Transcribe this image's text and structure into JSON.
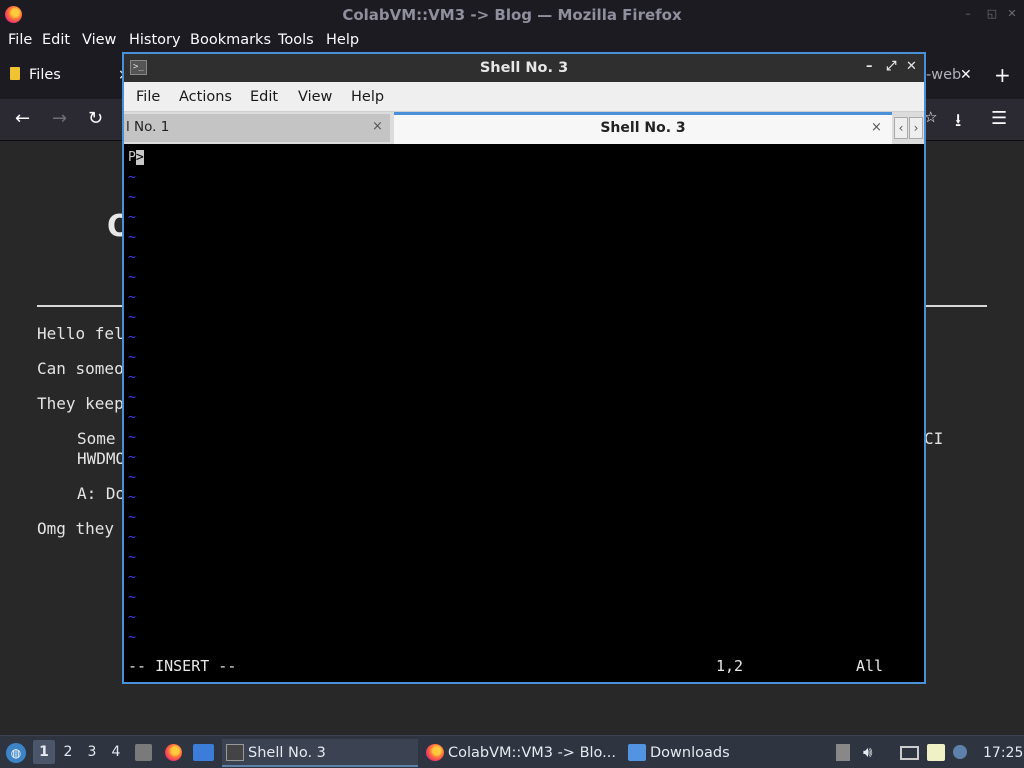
{
  "firefox": {
    "window_title": "ColabVM::VM3 -> Blog — Mozilla Firefox",
    "menu": [
      "File",
      "Edit",
      "View",
      "History",
      "Bookmarks",
      "Tools",
      "Help"
    ],
    "tab_files": "Files",
    "tab_right_fragment": "-web",
    "page": {
      "heading_fragment": "O",
      "lines": [
        "Hello fel",
        "Can someo",
        "They keep",
        "Some",
        "HWDMO",
        "A: Do",
        "Omg they"
      ],
      "right_fragment": "CI"
    }
  },
  "terminal": {
    "title": "Shell No. 3",
    "menu": [
      "File",
      "Actions",
      "Edit",
      "View",
      "Help"
    ],
    "tabs": [
      {
        "label": "l No. 1",
        "close": "×"
      },
      {
        "label": "Shell No. 3",
        "close": "×"
      }
    ],
    "prompt_text": "P",
    "cursor_char": ">",
    "tilde": "~",
    "tilde_count": 24,
    "mode": "-- INSERT --",
    "position": "1,2",
    "scroll": "All"
  },
  "taskbar": {
    "workspaces": [
      "1",
      "2",
      "3",
      "4"
    ],
    "active_workspace": "1",
    "tasks": [
      {
        "label": "Shell No. 3",
        "icon": "terminal-icon"
      },
      {
        "label": "ColabVM::VM3 -> Blo...",
        "icon": "firefox-icon"
      },
      {
        "label": "Downloads",
        "icon": "folder-icon"
      }
    ],
    "clock": "17:25"
  },
  "colors": {
    "accent": "#4a90d9",
    "tilde": "#4040ff"
  }
}
